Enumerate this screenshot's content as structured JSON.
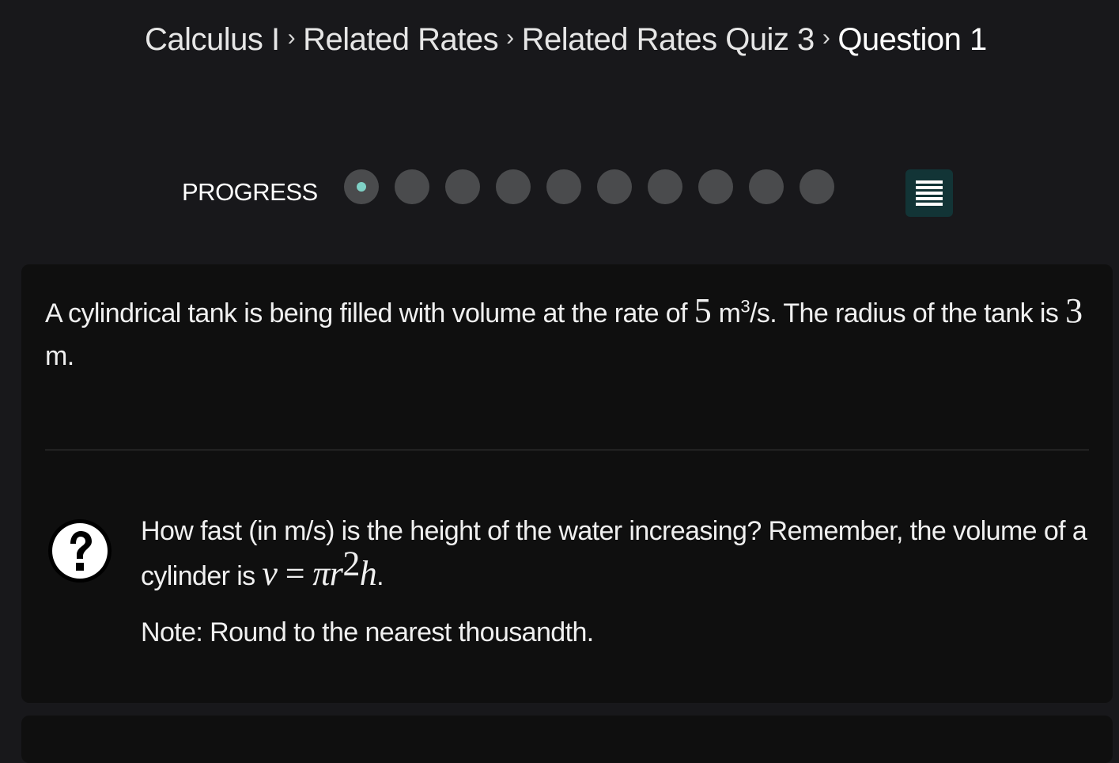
{
  "breadcrumb": {
    "items": [
      "Calculus I",
      "Related Rates",
      "Related Rates Quiz 3",
      "Question 1"
    ],
    "separator": "›"
  },
  "progress": {
    "label": "PROGRESS",
    "total": 10,
    "current": 1
  },
  "problem": {
    "text_before": "A cylindrical tank is being filled with volume at the rate of ",
    "rate_value": "5",
    "rate_unit": " m",
    "rate_unit_exp": "3",
    "text_after": "/s. The radius of the tank is ",
    "radius_value": "3",
    "radius_unit": " m."
  },
  "question": {
    "text": "How fast (in m/s) is the height of the water increasing? Remember, the volume of a cylinder is ",
    "formula_v": "v",
    "formula_eq": " = ",
    "formula_pi_r": "πr",
    "formula_exp": "2",
    "formula_h": "h",
    "formula_end": ".",
    "note": "Note: Round to the nearest thousandth."
  },
  "colors": {
    "background": "#18181b",
    "card": "#0f0f0f",
    "dot_inactive": "#4a4b4d",
    "dot_active_center": "#7fd1c6",
    "menu_button": "#123436"
  }
}
